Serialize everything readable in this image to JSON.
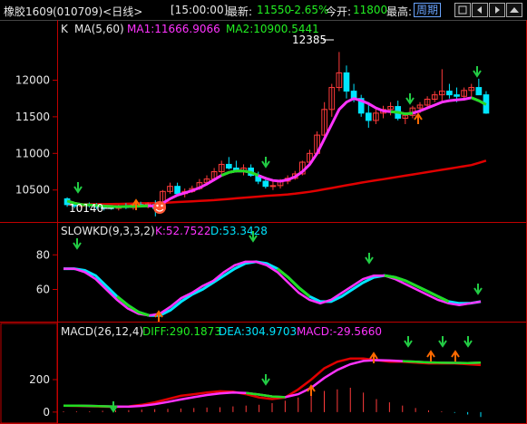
{
  "header": {
    "instrument": "橡胶1609",
    "code_period": "(010709)<日线>",
    "time": "[15:00:00]",
    "latest_label": "最新:",
    "latest_value": "11550",
    "change_pct": "-2.65%",
    "open_label": "今开:",
    "open_value": "11800",
    "high_label": "最高:",
    "period_button": "周期",
    "window_controls": [
      "square-icon",
      "prev-arrow-icon",
      "next-arrow-icon",
      "up-arrow-icon"
    ]
  },
  "main_panel": {
    "prefix": "K",
    "title": "MA(5,60)",
    "ma1_label": "MA1:11666.9066",
    "ma2_label": "MA2:10900.5441",
    "y_ticks": [
      12000,
      11500,
      11000,
      10500
    ],
    "high_marker": "12385",
    "low_marker": "10140",
    "ylim": [
      10150,
      12600
    ]
  },
  "kd_panel": {
    "title": "SLOWKD(9,3,3,2)",
    "k_label": "K:52.7522",
    "d_label": "D:53.3428",
    "y_ticks": [
      80,
      60
    ],
    "ylim": [
      43,
      88
    ]
  },
  "macd_panel": {
    "title": "MACD(26,12,4)",
    "diff_label": "DIFF:290.1873",
    "dea_label": "DEA:304.9703",
    "macd_label": "MACD:-29.5660",
    "y_ticks": [
      200,
      0
    ],
    "ylim": [
      -40,
      440
    ]
  },
  "colors": {
    "up": "#ff3b3b",
    "down": "#00e5ff",
    "ma_fast": "#ff33ff",
    "ma_slow": "#e00000",
    "kd_k": "#ff33ff",
    "kd_d": "#00e5ff",
    "trend_green": "#22dd22",
    "arrow_up": "#ff6a00",
    "arrow_down": "#22cc44",
    "axis": "#c00000"
  },
  "chart_data": [
    {
      "type": "candlestick",
      "title": "MA(5,60)",
      "series_ohlc": [
        [
          10380,
          10400,
          10270,
          10300
        ],
        [
          10300,
          10330,
          10250,
          10280
        ],
        [
          10280,
          10320,
          10250,
          10300
        ],
        [
          10300,
          10330,
          10260,
          10290
        ],
        [
          10290,
          10320,
          10240,
          10270
        ],
        [
          10270,
          10300,
          10220,
          10260
        ],
        [
          10260,
          10290,
          10230,
          10250
        ],
        [
          10250,
          10300,
          10220,
          10280
        ],
        [
          10280,
          10320,
          10240,
          10260
        ],
        [
          10260,
          10310,
          10230,
          10300
        ],
        [
          10300,
          10340,
          10260,
          10280
        ],
        [
          10280,
          10330,
          10250,
          10310
        ],
        [
          10300,
          10360,
          10140,
          10250
        ],
        [
          10250,
          10500,
          10240,
          10480
        ],
        [
          10480,
          10600,
          10450,
          10550
        ],
        [
          10550,
          10600,
          10420,
          10450
        ],
        [
          10450,
          10520,
          10400,
          10480
        ],
        [
          10480,
          10560,
          10460,
          10520
        ],
        [
          10520,
          10650,
          10500,
          10600
        ],
        [
          10600,
          10700,
          10560,
          10650
        ],
        [
          10650,
          10800,
          10620,
          10750
        ],
        [
          10750,
          10900,
          10720,
          10850
        ],
        [
          10850,
          10950,
          10780,
          10800
        ],
        [
          10800,
          10900,
          10740,
          10760
        ],
        [
          10760,
          10850,
          10700,
          10800
        ],
        [
          10800,
          10850,
          10680,
          10700
        ],
        [
          10700,
          10750,
          10580,
          10620
        ],
        [
          10620,
          10680,
          10520,
          10550
        ],
        [
          10550,
          10620,
          10500,
          10560
        ],
        [
          10560,
          10650,
          10520,
          10620
        ],
        [
          10620,
          10700,
          10580,
          10660
        ],
        [
          10660,
          10760,
          10640,
          10720
        ],
        [
          10720,
          10900,
          10700,
          10880
        ],
        [
          10880,
          11050,
          10850,
          11000
        ],
        [
          11000,
          11300,
          10980,
          11250
        ],
        [
          11250,
          11700,
          11200,
          11600
        ],
        [
          11600,
          11950,
          11500,
          11900
        ],
        [
          11900,
          12385,
          11850,
          12100
        ],
        [
          12100,
          12200,
          11750,
          11850
        ],
        [
          11850,
          11950,
          11700,
          11750
        ],
        [
          11750,
          11800,
          11500,
          11550
        ],
        [
          11550,
          11700,
          11350,
          11450
        ],
        [
          11450,
          11600,
          11400,
          11550
        ],
        [
          11550,
          11650,
          11480,
          11600
        ],
        [
          11600,
          11700,
          11520,
          11640
        ],
        [
          11640,
          11720,
          11450,
          11480
        ],
        [
          11480,
          11560,
          11400,
          11520
        ],
        [
          11520,
          11650,
          11480,
          11620
        ],
        [
          11620,
          11700,
          11550,
          11660
        ],
        [
          11660,
          11780,
          11620,
          11740
        ],
        [
          11740,
          11850,
          11700,
          11800
        ],
        [
          11800,
          12150,
          11720,
          11850
        ],
        [
          11850,
          11950,
          11750,
          11800
        ],
        [
          11800,
          11900,
          11700,
          11780
        ],
        [
          11780,
          11900,
          11720,
          11860
        ],
        [
          11860,
          11950,
          11780,
          11900
        ],
        [
          11900,
          12020,
          11800,
          11800
        ],
        [
          11800,
          11850,
          11540,
          11550
        ]
      ],
      "ma1": [
        10350,
        10320,
        10300,
        10295,
        10290,
        10280,
        10275,
        10270,
        10275,
        10278,
        10280,
        10285,
        10280,
        10320,
        10380,
        10430,
        10460,
        10490,
        10530,
        10580,
        10640,
        10700,
        10740,
        10760,
        10760,
        10740,
        10700,
        10660,
        10630,
        10620,
        10640,
        10680,
        10750,
        10850,
        11000,
        11200,
        11400,
        11600,
        11700,
        11750,
        11720,
        11680,
        11620,
        11580,
        11570,
        11560,
        11540,
        11550,
        11580,
        11620,
        11660,
        11700,
        11720,
        11730,
        11740,
        11760,
        11720,
        11667
      ],
      "ma2": [
        10300,
        10302,
        10305,
        10305,
        10306,
        10306,
        10308,
        10310,
        10312,
        10315,
        10318,
        10320,
        10322,
        10325,
        10330,
        10335,
        10340,
        10345,
        10350,
        10356,
        10362,
        10370,
        10378,
        10386,
        10394,
        10402,
        10410,
        10418,
        10425,
        10432,
        10440,
        10450,
        10462,
        10476,
        10492,
        10510,
        10528,
        10546,
        10564,
        10582,
        10600,
        10616,
        10632,
        10648,
        10664,
        10680,
        10696,
        10712,
        10728,
        10744,
        10760,
        10776,
        10792,
        10808,
        10824,
        10840,
        10870,
        10901
      ]
    },
    {
      "type": "line",
      "title": "SLOWKD(9,3,3,2)",
      "series": [
        {
          "name": "K",
          "values": [
            72,
            72,
            70,
            66,
            60,
            54,
            49,
            46,
            45,
            46,
            50,
            55,
            58,
            62,
            65,
            70,
            74,
            76,
            76,
            74,
            70,
            64,
            58,
            54,
            52,
            54,
            58,
            62,
            66,
            68,
            68,
            66,
            63,
            60,
            57,
            54,
            52,
            51,
            52,
            53
          ]
        },
        {
          "name": "D",
          "values": [
            72,
            72,
            71,
            68,
            62,
            56,
            51,
            47,
            45,
            45,
            48,
            53,
            57,
            60,
            64,
            68,
            72,
            75,
            76,
            75,
            72,
            67,
            61,
            56,
            53,
            53,
            56,
            60,
            64,
            67,
            68,
            67,
            65,
            62,
            59,
            56,
            53,
            52,
            52,
            53
          ]
        }
      ]
    },
    {
      "type": "line",
      "title": "MACD(26,12,4)",
      "series": [
        {
          "name": "DIFF",
          "values": [
            40,
            38,
            36,
            34,
            32,
            35,
            45,
            60,
            80,
            100,
            110,
            120,
            128,
            125,
            110,
            90,
            80,
            90,
            140,
            200,
            270,
            310,
            330,
            330,
            320,
            310,
            310,
            305,
            300,
            300,
            300,
            295,
            290
          ]
        },
        {
          "name": "DEA",
          "values": [
            40,
            39,
            38,
            36,
            34,
            33,
            38,
            48,
            62,
            78,
            92,
            105,
            115,
            120,
            118,
            108,
            96,
            92,
            110,
            150,
            210,
            260,
            295,
            315,
            320,
            318,
            314,
            310,
            306,
            304,
            303,
            302,
            305
          ]
        }
      ],
      "histogram": [
        5,
        5,
        5,
        8,
        10,
        12,
        15,
        18,
        20,
        22,
        25,
        28,
        30,
        35,
        40,
        45,
        55,
        70,
        90,
        110,
        130,
        140,
        150,
        120,
        80,
        60,
        40,
        25,
        10,
        5,
        -5,
        -15,
        -30
      ]
    }
  ]
}
